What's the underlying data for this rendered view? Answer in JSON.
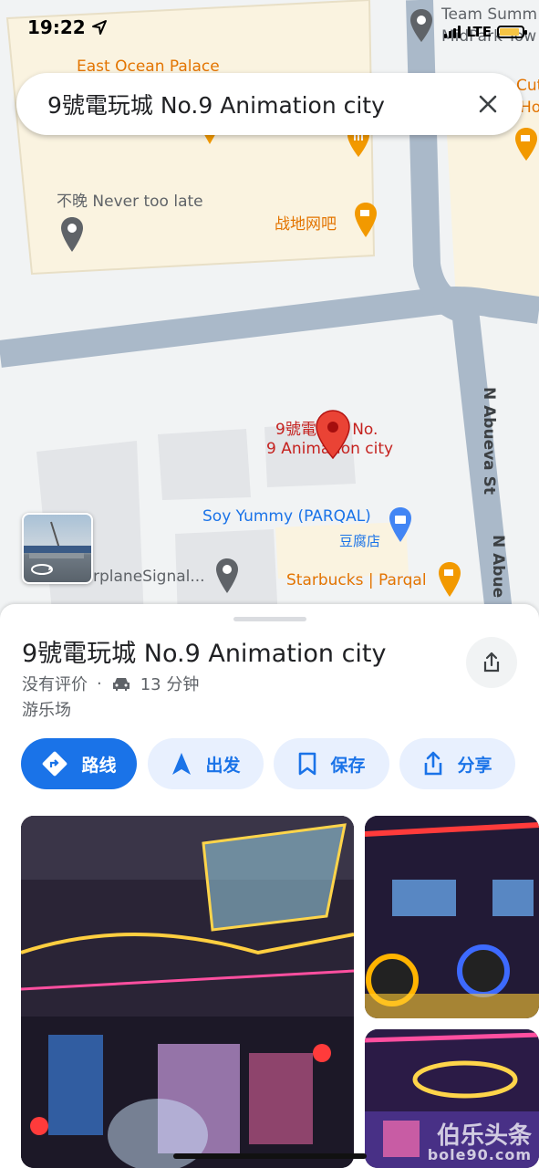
{
  "status_bar": {
    "time": "19:22",
    "network": "LTE"
  },
  "search": {
    "query": "9號電玩城 No.9 Animation city",
    "clear_icon": "close-icon"
  },
  "map": {
    "labels": {
      "east_ocean": "East Ocean Palace",
      "team_summ": "Team Summ",
      "midpark": "MidPark Tow",
      "never_too_late": "不晚 Never too late",
      "zhandi": "战地网吧",
      "selected_line1": "9號電玩城 No.",
      "selected_line2": "9 Animation city",
      "soy_yummy": "Soy Yummy (PARQAL)",
      "doufu": "豆腐店",
      "starbucks": "Starbucks | Parqal",
      "airplane": "rplaneSignal...",
      "cut": "Cut",
      "cut2": "Ho",
      "street1": "N Abueva St",
      "street2": "N Abue"
    },
    "colors": {
      "road": "#aab9c9",
      "block": "#faf3e0",
      "building": "#e3e5e8",
      "pin": "#ea4335"
    }
  },
  "sheet": {
    "title": "9號電玩城 No.9 Animation city",
    "rating": "没有评价",
    "separator": "·",
    "drive_time": "13 分钟",
    "category": "游乐场",
    "buttons": {
      "directions": "路线",
      "start": "出发",
      "save": "保存",
      "share": "分享"
    },
    "accent": "#1a73e8"
  },
  "watermark": {
    "line1": "伯乐头条",
    "line2": "bole90.com"
  }
}
